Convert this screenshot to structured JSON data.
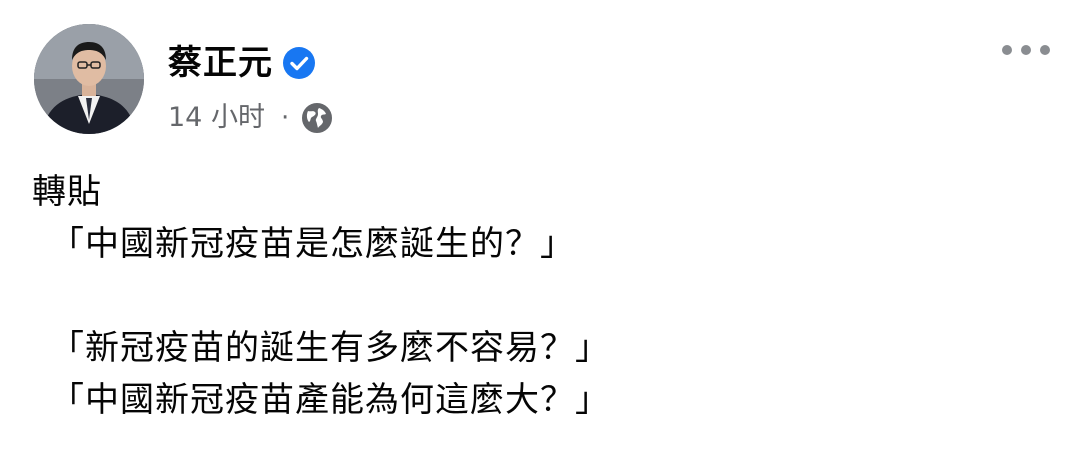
{
  "post": {
    "author": {
      "name": "蔡正元",
      "verified": true,
      "avatar_icon": "person-avatar"
    },
    "timestamp": "14 小时",
    "separator": "·",
    "audience_icon": "globe-icon",
    "more_icon": "more-options-icon",
    "content": {
      "line1": "轉貼",
      "line2": "「中國新冠疫苗是怎麼誕生的？」",
      "line3": "「新冠疫苗的誕生有多麼不容易？」",
      "line4": "「中國新冠疫苗產能為何這麼大？」"
    }
  },
  "colors": {
    "text_primary": "#050505",
    "text_secondary": "#65676b",
    "verified_badge": "#1877f2"
  }
}
